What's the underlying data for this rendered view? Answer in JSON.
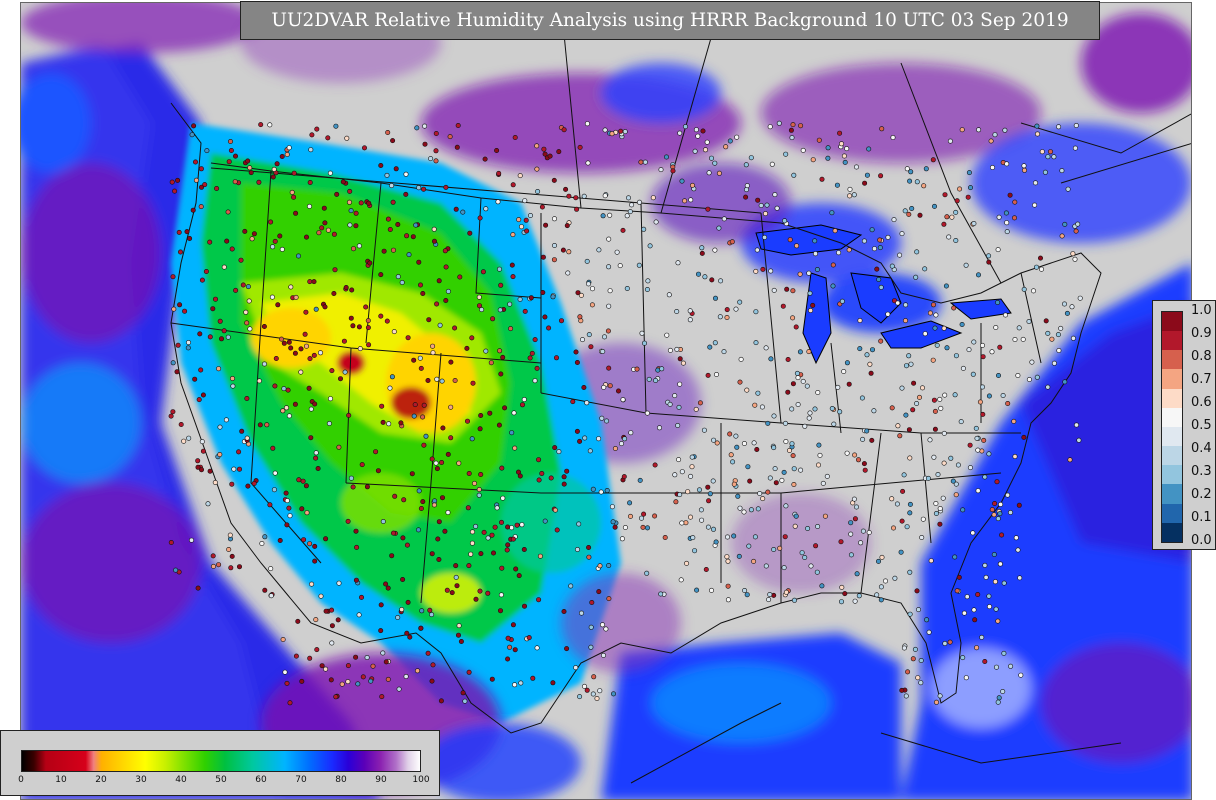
{
  "title": "UU2DVAR Relative Humidity Analysis using HRRR Background 10 UTC 03 Sep 2019",
  "observation_legend": {
    "labels": [
      "1.0",
      "0.9",
      "0.8",
      "0.7",
      "0.6",
      "0.5",
      "0.4",
      "0.3",
      "0.2",
      "0.1",
      "0.0"
    ],
    "colors": [
      "#8b0a1a",
      "#b2182b",
      "#d6604d",
      "#f4a582",
      "#fddbc7",
      "#f7f7f7",
      "#e0e8f0",
      "#bcd6e6",
      "#92c5de",
      "#4393c3",
      "#2166ac",
      "#053061"
    ]
  },
  "rh_colorbar": {
    "ticks": [
      "0",
      "10",
      "20",
      "30",
      "40",
      "50",
      "60",
      "70",
      "80",
      "90",
      "100"
    ]
  },
  "colors": {
    "background_gray": "#cfcfcf",
    "title_bar": "#858585",
    "ocean_blue": "#1a3cff",
    "dry_red": "#c4001c",
    "moist_purple": "#7a10b0"
  }
}
